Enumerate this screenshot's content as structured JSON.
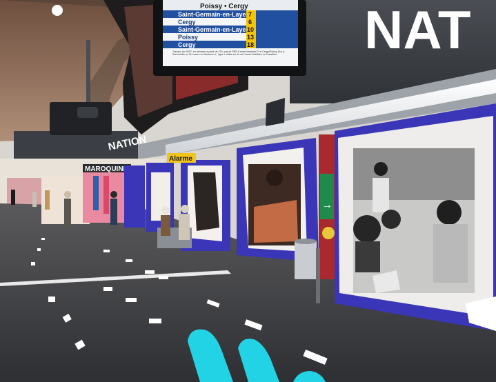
{
  "departure_board": {
    "header": "Poissy • Cergy",
    "rows": [
      {
        "destination": "Saint-Germain-en-Laye",
        "minutes": "7"
      },
      {
        "destination": "Cergy",
        "minutes": "6"
      },
      {
        "destination": "Saint-Germain-en-Laye",
        "minutes": "10"
      },
      {
        "destination": "Poissy",
        "minutes": "13"
      },
      {
        "destination": "Cergy",
        "minutes": "18"
      }
    ],
    "notice": "Travaux du 03/07, en semaine à partir de 22h, pas de RER A entre Nanterre-P. et Cergy/Poissy. Bus à Sartrouville ou St-Lazare ou Nanterre-U., ligne L reliée sur Ile de France Mobilités ou Transilien"
  },
  "station_sign": {
    "text": "NAT"
  },
  "station_sign_small": {
    "text": "NATION"
  },
  "shop_sign": {
    "text": "MAROQUINERIE"
  },
  "alarm_sign": {
    "text": "Alarme"
  },
  "colors": {
    "platform_floor": "#3a3b3f",
    "poster_blue": "#3b35b8",
    "cyan_logo": "#22d3e6",
    "sign_dark": "#3c3f45",
    "ceiling_vault": "#8a6a58",
    "exit_green": "#1f8a4c"
  },
  "icons": [
    "exit-arrow-icon",
    "accessibility-icon"
  ]
}
